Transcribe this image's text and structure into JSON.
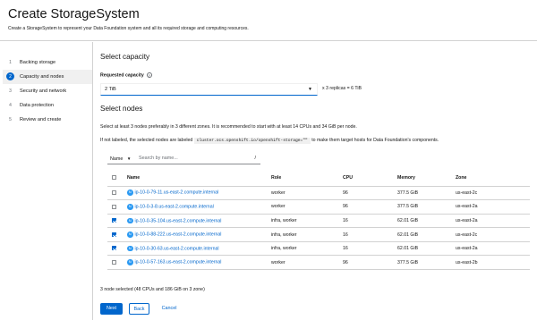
{
  "header": {
    "title": "Create StorageSystem",
    "subtitle": "Create a StorageSystem to represent your Data Foundation system and all its required storage and computing resources."
  },
  "wizard": {
    "steps": [
      {
        "num": "1",
        "label": "Backing storage"
      },
      {
        "num": "2",
        "label": "Capacity and nodes"
      },
      {
        "num": "3",
        "label": "Security and network"
      },
      {
        "num": "4",
        "label": "Data protection"
      },
      {
        "num": "5",
        "label": "Review and create"
      }
    ]
  },
  "capacity": {
    "heading": "Select capacity",
    "label": "Requested capacity",
    "value": "2 TiB",
    "replicas_note": "x 3 replicas = 6 TiB"
  },
  "nodes": {
    "heading": "Select nodes",
    "instruction": "Select at least 3 nodes preferably in 3 different zones. It is recommended to start with at least 14 CPUs and 34 GiB per node.",
    "label_note_prefix": "If not labeled, the selected nodes are labeled",
    "label_code": "cluster.ocs.openshift.io/openshift-storage=\"\"",
    "label_note_suffix": "to make them target hosts for Data Foundation's components.",
    "filter_select": "Name",
    "filter_placeholder": "Search by name...",
    "filter_slash": "/",
    "columns": [
      "Name",
      "Role",
      "CPU",
      "Memory",
      "Zone"
    ],
    "rows": [
      {
        "checked": false,
        "name": "ip-10-0-79-11.us-east-2.compute.internal",
        "role": "worker",
        "cpu": "96",
        "memory": "377.5 GiB",
        "zone": "us-east-2c"
      },
      {
        "checked": false,
        "name": "ip-10-0-3-8.us-east-2.compute.internal",
        "role": "worker",
        "cpu": "96",
        "memory": "377.5 GiB",
        "zone": "us-east-2a"
      },
      {
        "checked": true,
        "name": "ip-10-0-35-104.us-east-2.compute.internal",
        "role": "infra, worker",
        "cpu": "16",
        "memory": "62.01 GiB",
        "zone": "us-east-2a"
      },
      {
        "checked": true,
        "name": "ip-10-0-88-222.us-east-2.compute.internal",
        "role": "infra, worker",
        "cpu": "16",
        "memory": "62.01 GiB",
        "zone": "us-east-2c"
      },
      {
        "checked": true,
        "name": "ip-10-0-30-63.us-east-2.compute.internal",
        "role": "infra, worker",
        "cpu": "16",
        "memory": "62.01 GiB",
        "zone": "us-east-2a"
      },
      {
        "checked": false,
        "name": "ip-10-0-57-163.us-east-2.compute.internal",
        "role": "worker",
        "cpu": "96",
        "memory": "377.5 GiB",
        "zone": "us-east-2b"
      }
    ],
    "node_badge": "N",
    "summary": "3 node selected (48 CPUs and 186 GiB on 3 zone)"
  },
  "footer": {
    "next": "Next",
    "back": "Back",
    "cancel": "Cancel"
  },
  "colors": {
    "accent": "#0066cc",
    "node_badge": "#2b9af3"
  }
}
